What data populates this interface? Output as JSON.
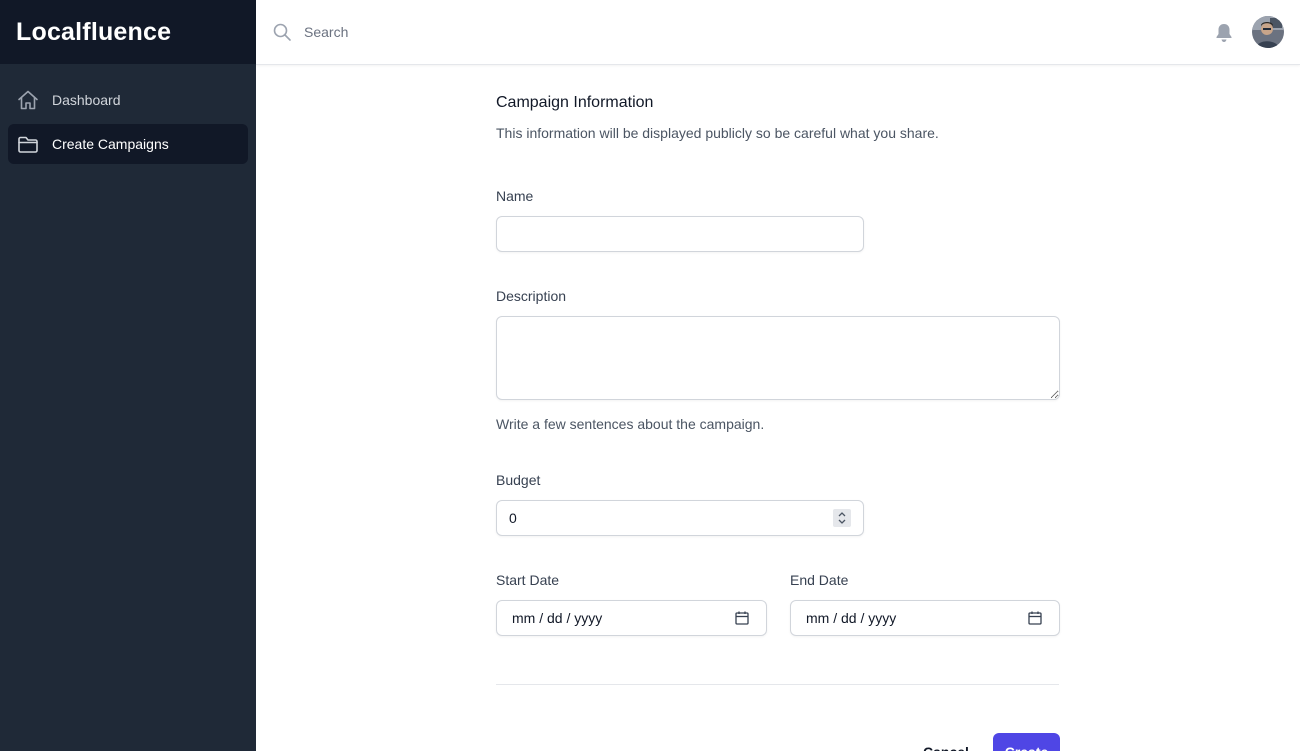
{
  "app": {
    "brand": "Localfluence"
  },
  "sidebar": {
    "items": [
      {
        "label": "Dashboard",
        "icon": "home-icon",
        "active": false
      },
      {
        "label": "Create Campaigns",
        "icon": "folder-icon",
        "active": true
      }
    ]
  },
  "header": {
    "search_placeholder": "Search",
    "notification_icon": "bell-icon",
    "avatar": "user-avatar"
  },
  "form": {
    "title": "Campaign Information",
    "description": "This information will be displayed publicly so be careful what you share.",
    "name_label": "Name",
    "name_value": "",
    "description_label": "Description",
    "description_value": "",
    "description_help": "Write a few sentences about the campaign.",
    "budget_label": "Budget",
    "budget_value": "0",
    "start_date_label": "Start Date",
    "start_date_placeholder": "mm / dd / yyyy",
    "end_date_label": "End Date",
    "end_date_placeholder": "mm / dd / yyyy",
    "cancel_label": "Cancel",
    "create_label": "Create"
  },
  "colors": {
    "sidebar_bg": "#1f2937",
    "brand_bg": "#111827",
    "accent": "#4f46e5"
  }
}
